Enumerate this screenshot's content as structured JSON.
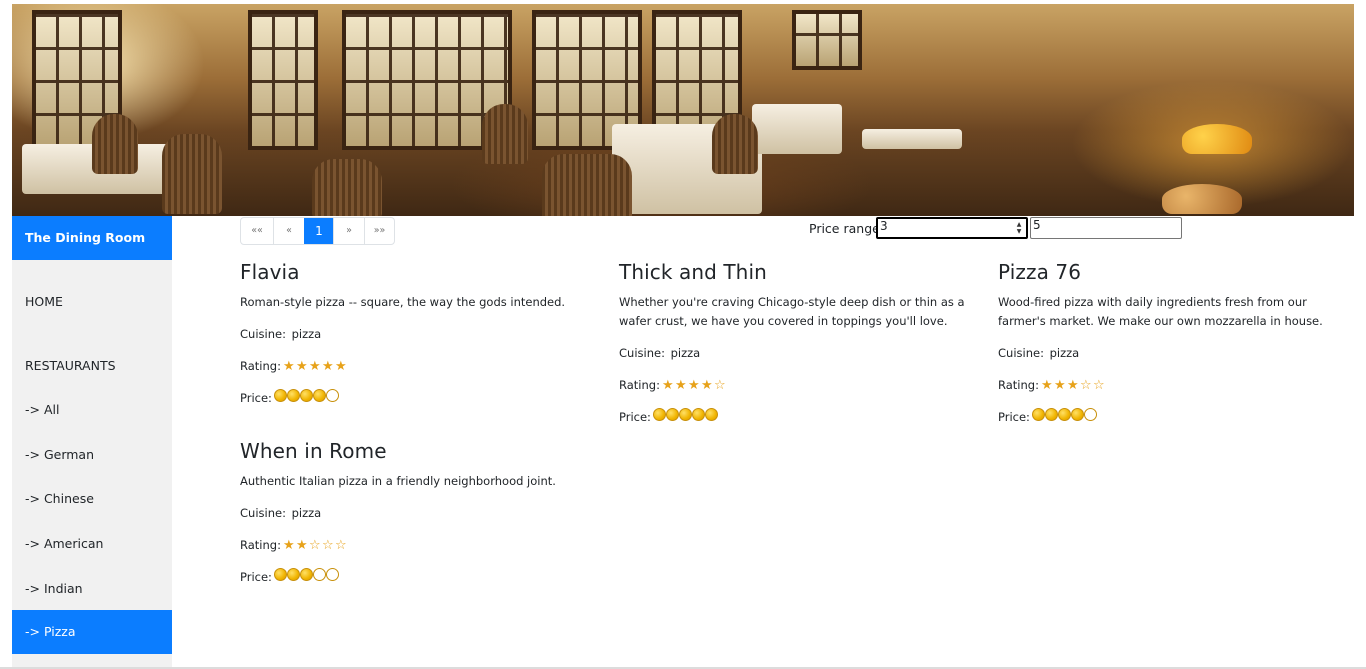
{
  "sidebar": {
    "brand": "The Dining Room",
    "items": [
      {
        "label": "HOME"
      },
      {
        "label": "RESTAURANTS"
      },
      {
        "label": "-> All"
      },
      {
        "label": "-> German"
      },
      {
        "label": "-> Chinese"
      },
      {
        "label": "-> American"
      },
      {
        "label": "-> Indian"
      },
      {
        "label": "-> Pizza",
        "active": true
      }
    ]
  },
  "pagination": {
    "first": "««",
    "prev": "«",
    "current": "1",
    "next": "»",
    "last": "»»"
  },
  "price_range": {
    "label": "Price range",
    "min": "3",
    "max": "5"
  },
  "labels": {
    "cuisine": "Cuisine:",
    "rating": "Rating:",
    "price": "Price:"
  },
  "restaurants": [
    {
      "name": "Flavia",
      "description": "Roman-style pizza -- square, the way the gods intended.",
      "cuisine": "pizza",
      "rating": 5,
      "price": 4
    },
    {
      "name": "Thick and Thin",
      "description": "Whether you're craving Chicago-style deep dish or thin as a wafer crust, we have you covered in toppings you'll love.",
      "cuisine": "pizza",
      "rating": 4,
      "price": 5
    },
    {
      "name": "Pizza 76",
      "description": "Wood-fired pizza with daily ingredients fresh from our farmer's market. We make our own mozzarella in house.",
      "cuisine": "pizza",
      "rating": 3,
      "price": 4
    },
    {
      "name": "When in Rome",
      "description": "Authentic Italian pizza in a friendly neighborhood joint.",
      "cuisine": "pizza",
      "rating": 2,
      "price": 3
    }
  ],
  "colors": {
    "accent": "#0b7dff",
    "sidebar_bg": "#f1f1f1",
    "star": "#e7a21a",
    "coin": "#f0b400"
  },
  "icons": {
    "rating": "star-icon",
    "price": "coin-icon"
  }
}
